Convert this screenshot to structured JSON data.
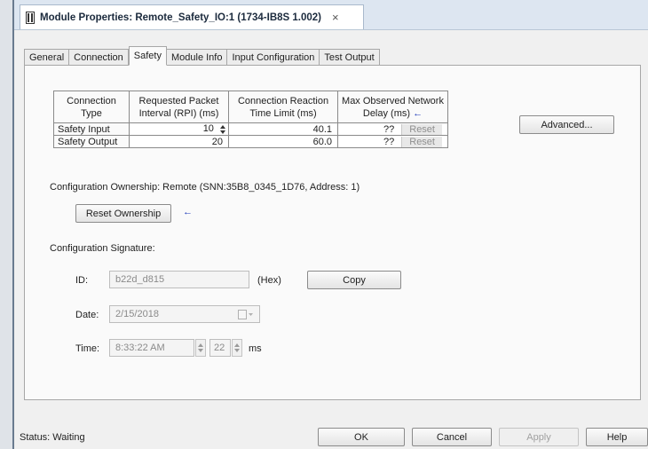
{
  "window": {
    "title": "Module Properties: Remote_Safety_IO:1 (1734-IB8S 1.002)",
    "close_glyph": "×"
  },
  "tabs": [
    {
      "label": "General",
      "active": false
    },
    {
      "label": "Connection",
      "active": false
    },
    {
      "label": "Safety",
      "active": true
    },
    {
      "label": "Module Info",
      "active": false
    },
    {
      "label": "Input Configuration",
      "active": false
    },
    {
      "label": "Test Output",
      "active": false
    }
  ],
  "safety_table": {
    "headers": {
      "type": "Connection Type",
      "rpi": "Requested Packet Interval (RPI) (ms)",
      "reaction": "Connection Reaction Time Limit (ms)",
      "delay": "Max Observed Network Delay (ms)"
    },
    "rows": [
      {
        "type": "Safety Input",
        "rpi": "10",
        "reaction": "40.1",
        "delay": "??",
        "reset": "Reset"
      },
      {
        "type": "Safety Output",
        "rpi": "20",
        "reaction": "60.0",
        "delay": "??",
        "reset": "Reset"
      }
    ]
  },
  "advanced_label": "Advanced...",
  "ownership": {
    "text": "Configuration Ownership: Remote (SNN:35B8_0345_1D76, Address: 1)",
    "reset_label": "Reset Ownership"
  },
  "signature": {
    "title": "Configuration Signature:",
    "id_label": "ID:",
    "id_value": "b22d_d815",
    "id_suffix": "(Hex)",
    "copy_label": "Copy",
    "date_label": "Date:",
    "date_value": "2/15/2018",
    "time_label": "Time:",
    "time_value": "8:33:22 AM",
    "ms_value": "22",
    "ms_suffix": "ms"
  },
  "status": "Status: Waiting",
  "buttons": {
    "ok": "OK",
    "cancel": "Cancel",
    "apply": "Apply",
    "help": "Help"
  },
  "colors": {
    "accent_arrow": "#1a36b8",
    "window_bg": "#f0f0f0",
    "titlebar_bg": "#dde6f1"
  },
  "icons": [
    "document-icon",
    "close-icon",
    "spin-updown-icon",
    "calendar-icon",
    "left-arrow-icon"
  ]
}
